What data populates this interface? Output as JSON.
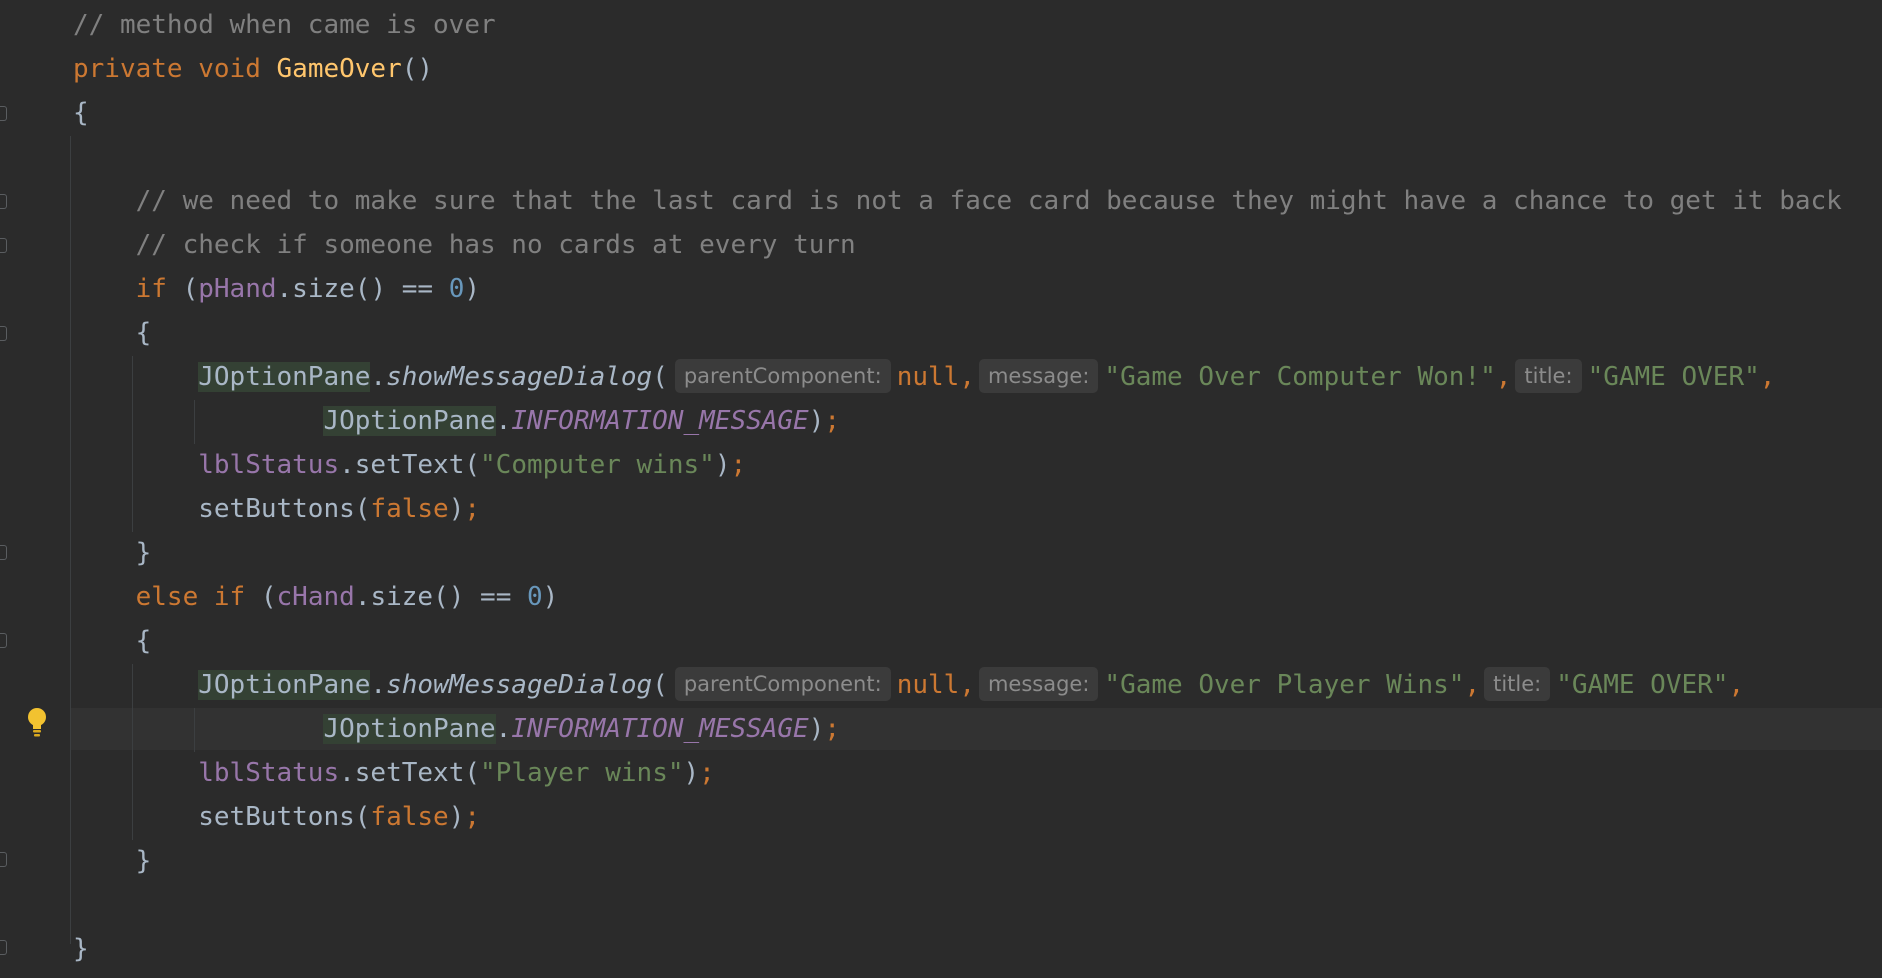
{
  "editor": {
    "code": {
      "comment_gameover": "// method when came is over",
      "kw_private": "private",
      "kw_void": "void",
      "method_name": "GameOver",
      "parens": "()",
      "brace_open": "{",
      "brace_close": "}",
      "comment_face_card": "// we need to make sure that the last card is not a face card because they might have a chance to get it back",
      "comment_check": "// check if someone has no cards at every turn",
      "kw_if": "if",
      "kw_else": "else",
      "kw_null": "null",
      "kw_false": "false",
      "p_hand": "pHand",
      "c_hand": "cHand",
      "size_call": ".size() == ",
      "zero": "0",
      "joption_pane": "JOptionPane",
      "show_message_dialog": "showMessageDialog",
      "information_message": "INFORMATION_MESSAGE",
      "lbl_status": "lblStatus",
      "set_text": ".setText(",
      "set_buttons": "setButtons(",
      "hint_parent": "parentComponent:",
      "hint_message": "message:",
      "hint_title": "title:",
      "str_computer_won": "\"Game Over Computer Won!\"",
      "str_player_wins": "\"Game Over Player Wins\"",
      "str_game_over": "\"GAME OVER\"",
      "str_computer_wins": "\"Computer wins\"",
      "str_player_wins_short": "\"Player wins\""
    },
    "icons": {
      "intention": "lightbulb-icon",
      "fold": "fold-marker-icon"
    },
    "colors": {
      "background": "#2b2b2b",
      "keyword": "#cc7832",
      "string": "#6a8759",
      "field": "#9876aa",
      "number": "#6897bb",
      "comment": "#808080",
      "method_decl": "#ffc66d"
    }
  }
}
